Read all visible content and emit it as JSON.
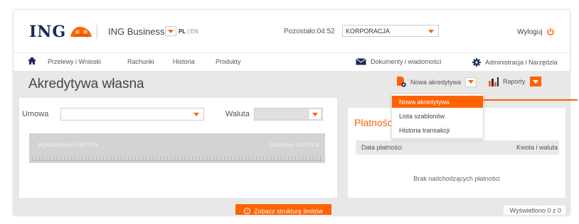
{
  "header": {
    "logo_text": "ING",
    "app_name": "ING Business",
    "lang_active": "PL",
    "lang_sep": " | ",
    "lang_other": "EN",
    "timer_label": "Pozostało:",
    "timer_value": "04:52",
    "company": "KORPORACJA",
    "logout": "Wyloguj"
  },
  "nav": {
    "items": [
      "Przelewy i Wnioski",
      "Rachunki",
      "Historia",
      "Produkty"
    ],
    "documents": "Dokumenty i wiadomości",
    "admin": "Administracja i Narzędzia"
  },
  "page": {
    "title": "Akredytywa własna",
    "new_button": "Nowa akredytywa",
    "reports_button": "Raporty"
  },
  "new_menu": {
    "items": [
      "Nowa akredytywa",
      "Lista szablonów",
      "Historia transakcji"
    ],
    "active_index": 0
  },
  "filters": {
    "contract_label": "Umowa",
    "contract_value": "",
    "currency_label": "Waluta",
    "currency_value": ""
  },
  "limits": {
    "used": "Wykorzystany 0,00 PLN",
    "available": "Dostępny 0,00 PLN",
    "structure_button": "Zobacz strukturę limitów"
  },
  "payments": {
    "title": "Płatności",
    "col_date": "Data płatności",
    "col_amount": "Kwota i waluta",
    "empty": "Brak nadchodzących płatności",
    "shown": "Wyświetlono 0 z 0"
  },
  "colors": {
    "accent": "#ff6200",
    "navy": "#1a2a5a",
    "panel_bg": "#e8e8e8"
  }
}
